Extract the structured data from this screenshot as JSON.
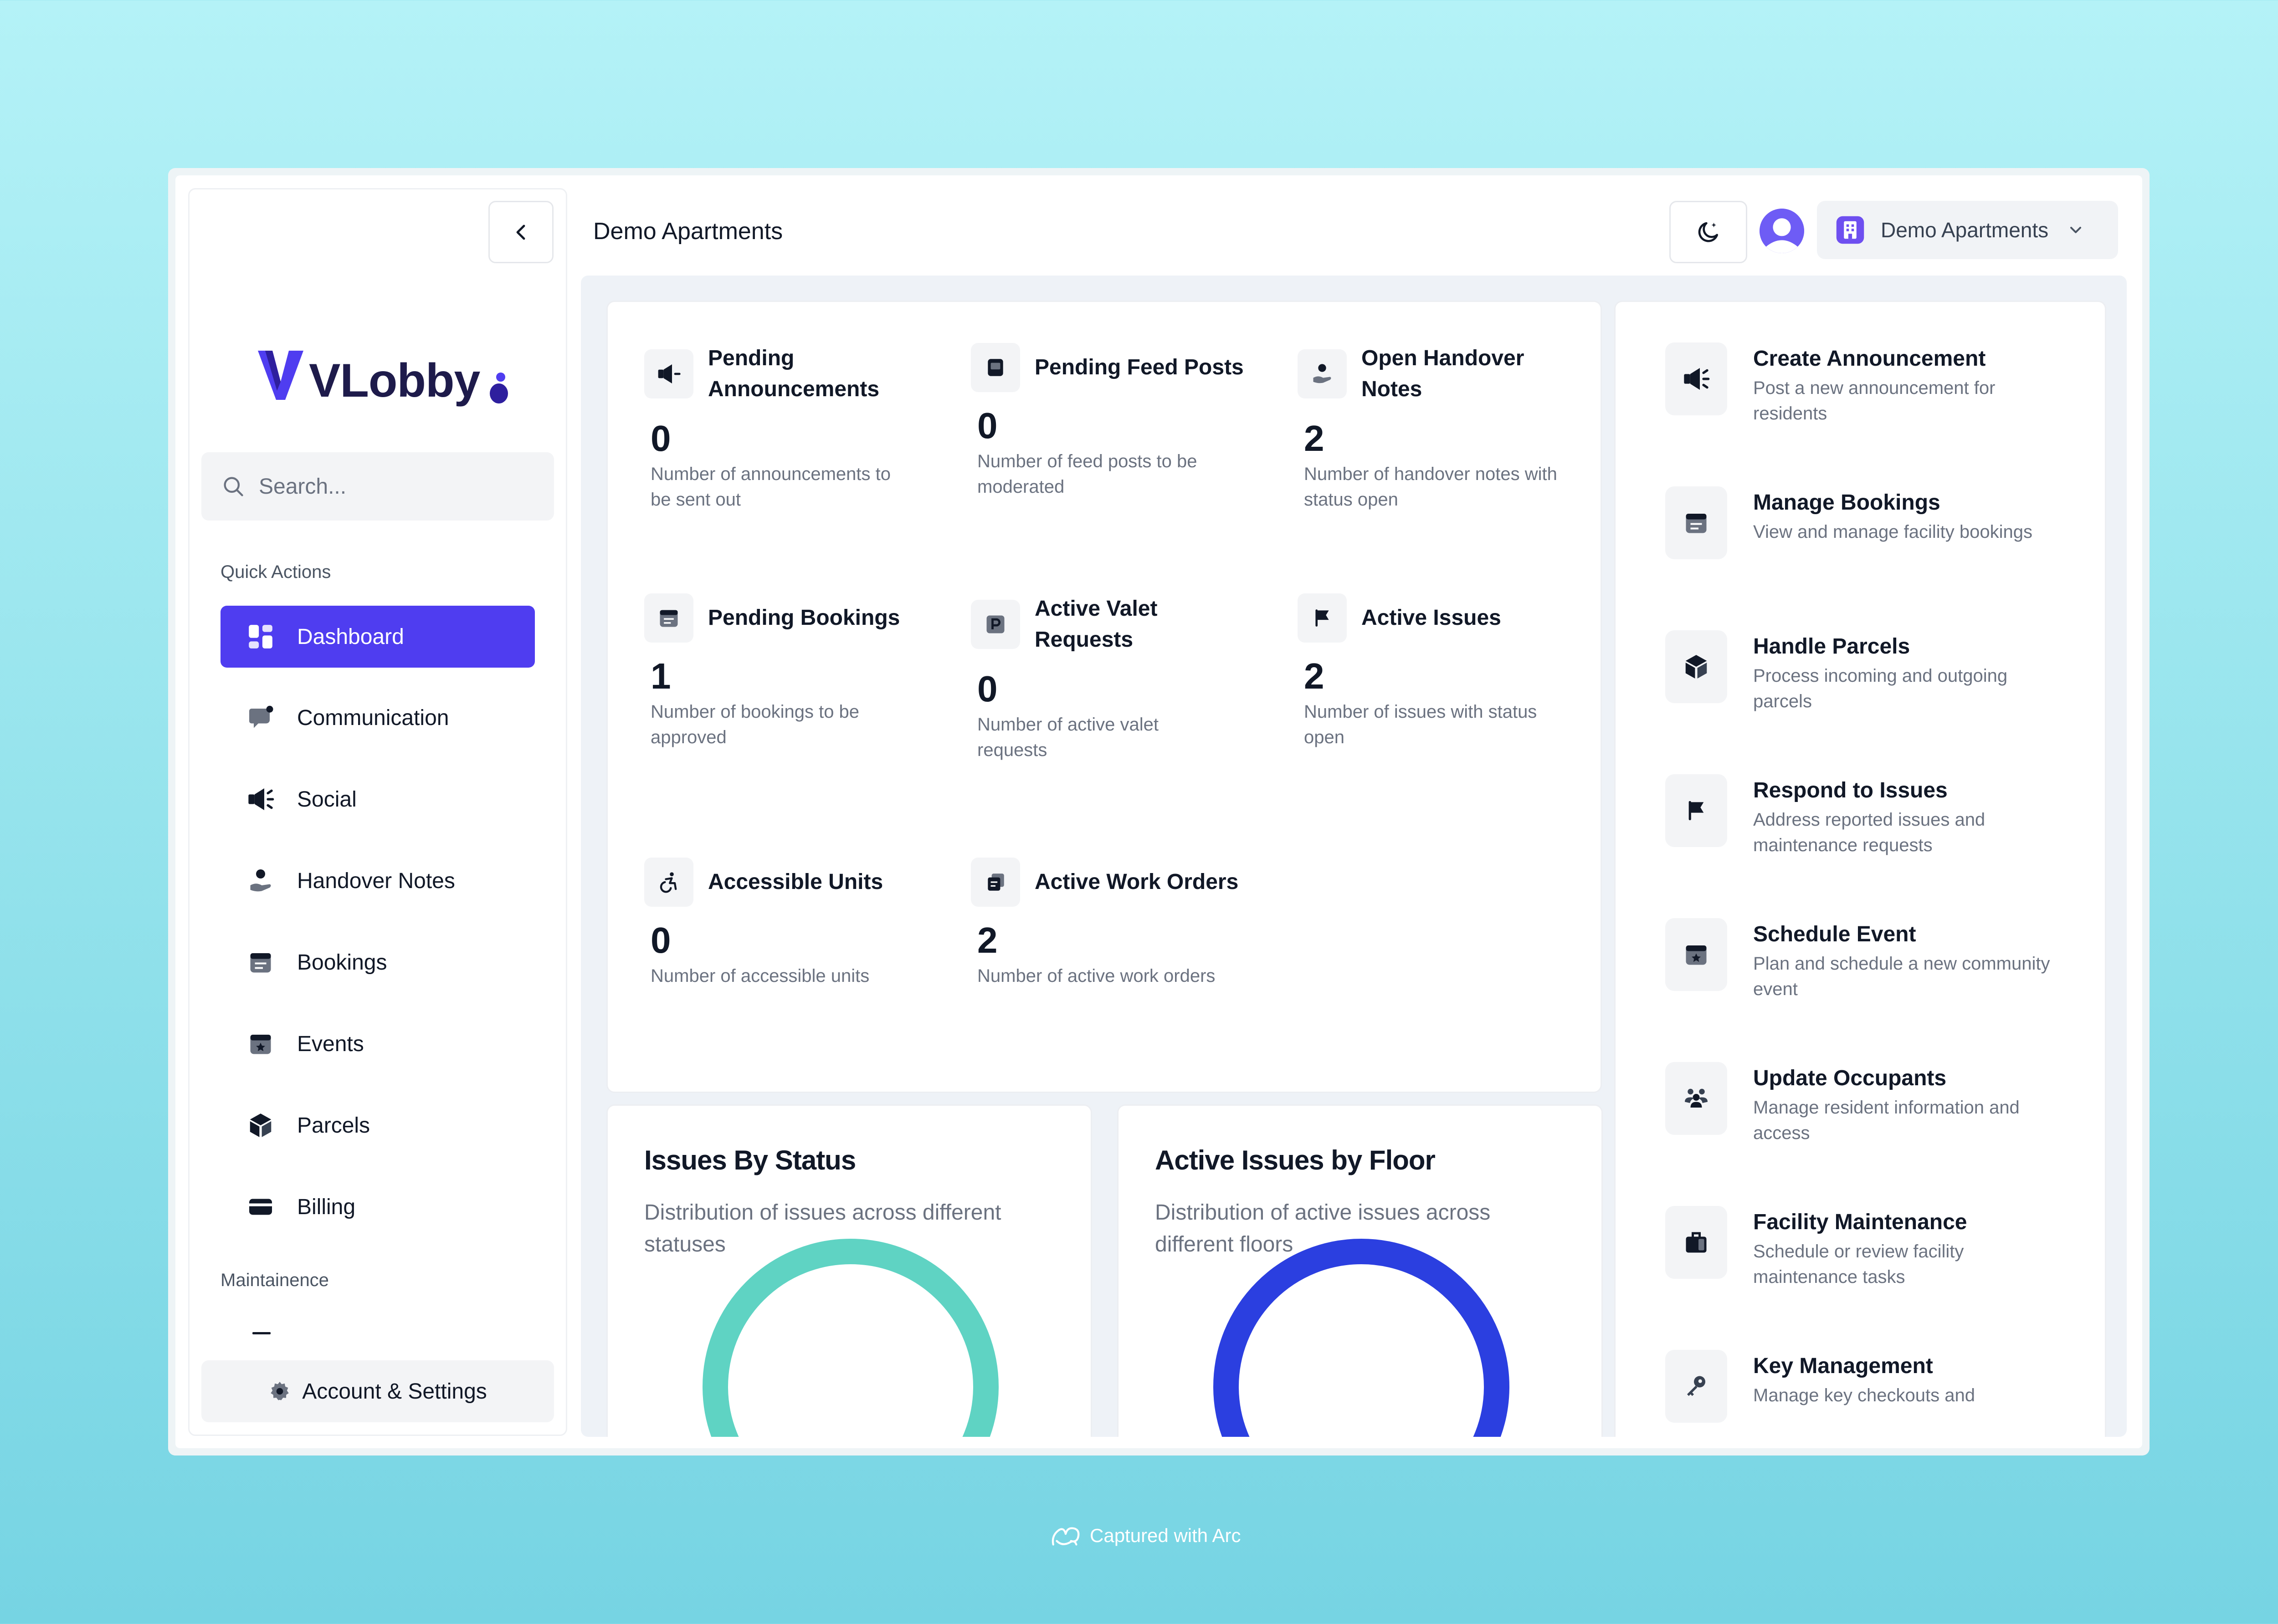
{
  "header": {
    "title": "Demo Apartments",
    "org_selector": "Demo Apartments",
    "theme_toggle_icon": "moon-icon",
    "back_icon": "chevron-left-icon"
  },
  "brand": {
    "logo_text": "VLobby",
    "accent": "#4f3df0"
  },
  "sidebar": {
    "search_placeholder": "Search...",
    "quick_actions_label": "Quick Actions",
    "maintenance_label": "Maintainence",
    "items": [
      {
        "label": "Dashboard",
        "icon": "dashboard-icon",
        "active": true
      },
      {
        "label": "Communication",
        "icon": "chat-icon",
        "active": false
      },
      {
        "label": "Social",
        "icon": "megaphone-icon",
        "active": false
      },
      {
        "label": "Handover Notes",
        "icon": "person-hand-icon",
        "active": false
      },
      {
        "label": "Bookings",
        "icon": "calendar-list-icon",
        "active": false
      },
      {
        "label": "Events",
        "icon": "calendar-star-icon",
        "active": false
      },
      {
        "label": "Parcels",
        "icon": "box-icon",
        "active": false
      },
      {
        "label": "Billing",
        "icon": "credit-card-icon",
        "active": false
      }
    ],
    "account_label": "Account & Settings"
  },
  "stats": [
    {
      "title": "Pending Announcements",
      "value": "0",
      "desc": "Number of announcements to be sent out",
      "icon": "megaphone-icon"
    },
    {
      "title": "Pending Feed Posts",
      "value": "0",
      "desc": "Number of feed posts to be moderated",
      "icon": "post-icon"
    },
    {
      "title": "Open Handover Notes",
      "value": "2",
      "desc": "Number of handover notes with status open",
      "icon": "person-hand-icon"
    },
    {
      "title": "Pending Bookings",
      "value": "1",
      "desc": "Number of bookings to be approved",
      "icon": "calendar-list-icon"
    },
    {
      "title": "Active Valet Requests",
      "value": "0",
      "desc": "Number of active valet requests",
      "icon": "parking-icon"
    },
    {
      "title": "Active Issues",
      "value": "2",
      "desc": "Number of issues with status open",
      "icon": "flag-icon"
    },
    {
      "title": "Accessible Units",
      "value": "0",
      "desc": "Number of accessible units",
      "icon": "accessibility-icon"
    },
    {
      "title": "Active Work Orders",
      "value": "2",
      "desc": "Number of active work orders",
      "icon": "work-order-icon"
    }
  ],
  "charts": [
    {
      "title": "Issues By Status",
      "subtitle": "Distribution of issues across different statuses",
      "color": "#5fd3c3"
    },
    {
      "title": "Active Issues by Floor",
      "subtitle": "Distribution of active issues across different floors",
      "color": "#2b3fe0"
    }
  ],
  "actions": [
    {
      "title": "Create Announcement",
      "desc": "Post a new announcement for residents",
      "icon": "megaphone-icon"
    },
    {
      "title": "Manage Bookings",
      "desc": "View and manage facility bookings",
      "icon": "calendar-list-icon"
    },
    {
      "title": "Handle Parcels",
      "desc": "Process incoming and outgoing parcels",
      "icon": "box-icon"
    },
    {
      "title": "Respond to Issues",
      "desc": "Address reported issues and maintenance requests",
      "icon": "flag-icon"
    },
    {
      "title": "Schedule Event",
      "desc": "Plan and schedule a new community event",
      "icon": "calendar-star-icon"
    },
    {
      "title": "Update Occupants",
      "desc": "Manage resident information and access",
      "icon": "people-icon"
    },
    {
      "title": "Facility Maintenance",
      "desc": "Schedule or review facility maintenance tasks",
      "icon": "toolbox-icon"
    },
    {
      "title": "Key Management",
      "desc": "Manage key checkouts and",
      "icon": "key-icon"
    }
  ],
  "footer": {
    "capture_label": "Captured with Arc"
  }
}
